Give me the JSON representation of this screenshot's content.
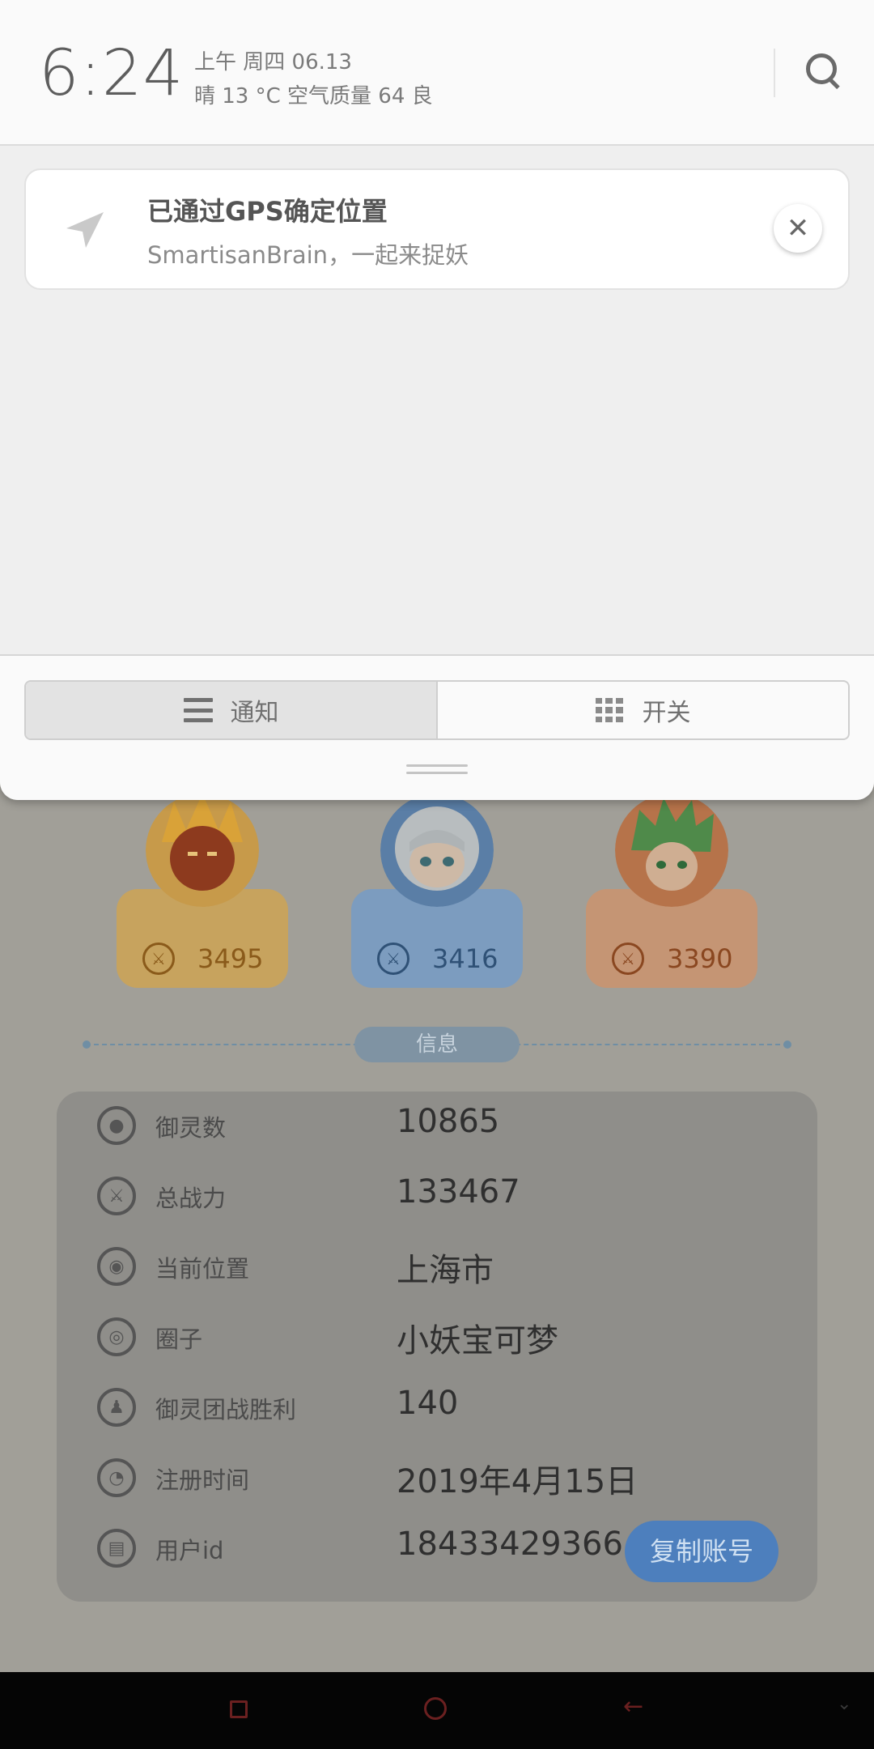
{
  "status": {
    "time": "6:24",
    "date": "上午  周四   06.13",
    "weather": "晴    13 °C    空气质量 64    良"
  },
  "notification": {
    "title": "已通过GPS确定位置",
    "body": "SmartisanBrain，一起来捉妖",
    "close_symbol": "✕"
  },
  "tabs": [
    {
      "label": "通知",
      "icon": "list-icon",
      "active": true
    },
    {
      "label": "开关",
      "icon": "grid-icon",
      "active": false
    }
  ],
  "heroes": [
    {
      "score": "3495",
      "color": "#c7a35e"
    },
    {
      "score": "3416",
      "color": "#7c9cbf"
    },
    {
      "score": "3390",
      "color": "#c59574"
    }
  ],
  "info": {
    "section_label": "信息",
    "rows": [
      {
        "label": "御灵数",
        "value": "10865",
        "icon": "spirit-icon"
      },
      {
        "label": "总战力",
        "value": "133467",
        "icon": "power-icon"
      },
      {
        "label": "当前位置",
        "value": "上海市",
        "icon": "location-icon"
      },
      {
        "label": "圈子",
        "value": "小妖宝可梦",
        "icon": "circle-icon"
      },
      {
        "label": "御灵团战胜利",
        "value": "140",
        "icon": "battle-icon"
      },
      {
        "label": "注册时间",
        "value": "2019年4月15日",
        "icon": "clock-icon"
      },
      {
        "label": "用户id",
        "value": "18433429366",
        "icon": "id-icon"
      }
    ],
    "copy_button": "复制账号"
  }
}
